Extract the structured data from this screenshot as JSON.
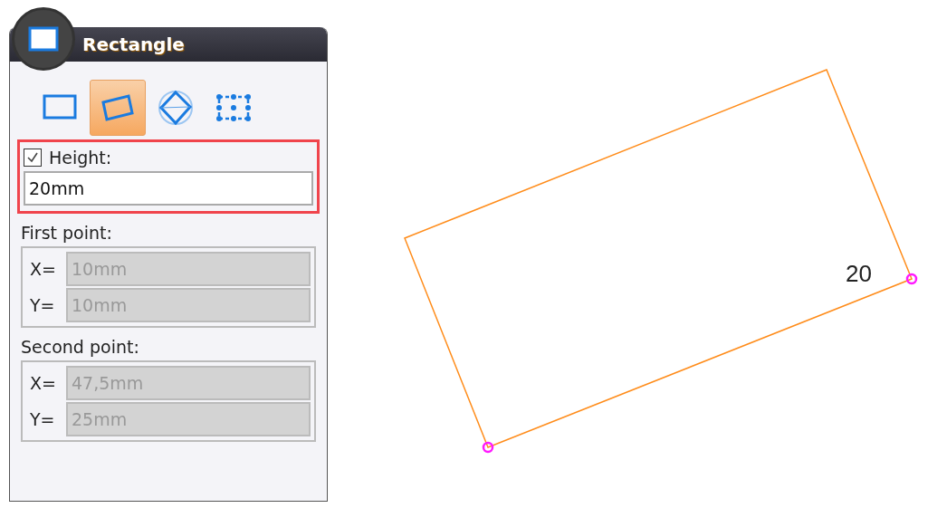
{
  "panel": {
    "title": "Rectangle",
    "tools": [
      {
        "kind": "rectangle",
        "selected": false
      },
      {
        "kind": "rotated",
        "selected": true
      },
      {
        "kind": "diagonal",
        "selected": false
      },
      {
        "kind": "center",
        "selected": false
      }
    ],
    "height": {
      "label": "Height:",
      "checked": true,
      "value": "20mm",
      "highlighted": true
    },
    "points": [
      {
        "label": "First point:",
        "fields": [
          {
            "label": "X=",
            "value": "10mm",
            "disabled": true
          },
          {
            "label": "Y=",
            "value": "10mm",
            "disabled": true
          }
        ]
      },
      {
        "label": "Second point:",
        "fields": [
          {
            "label": "X=",
            "value": "47,5mm",
            "disabled": true
          },
          {
            "label": "Y=",
            "value": "25mm",
            "disabled": true
          }
        ]
      }
    ]
  },
  "canvas": {
    "dimension_label": "20"
  }
}
